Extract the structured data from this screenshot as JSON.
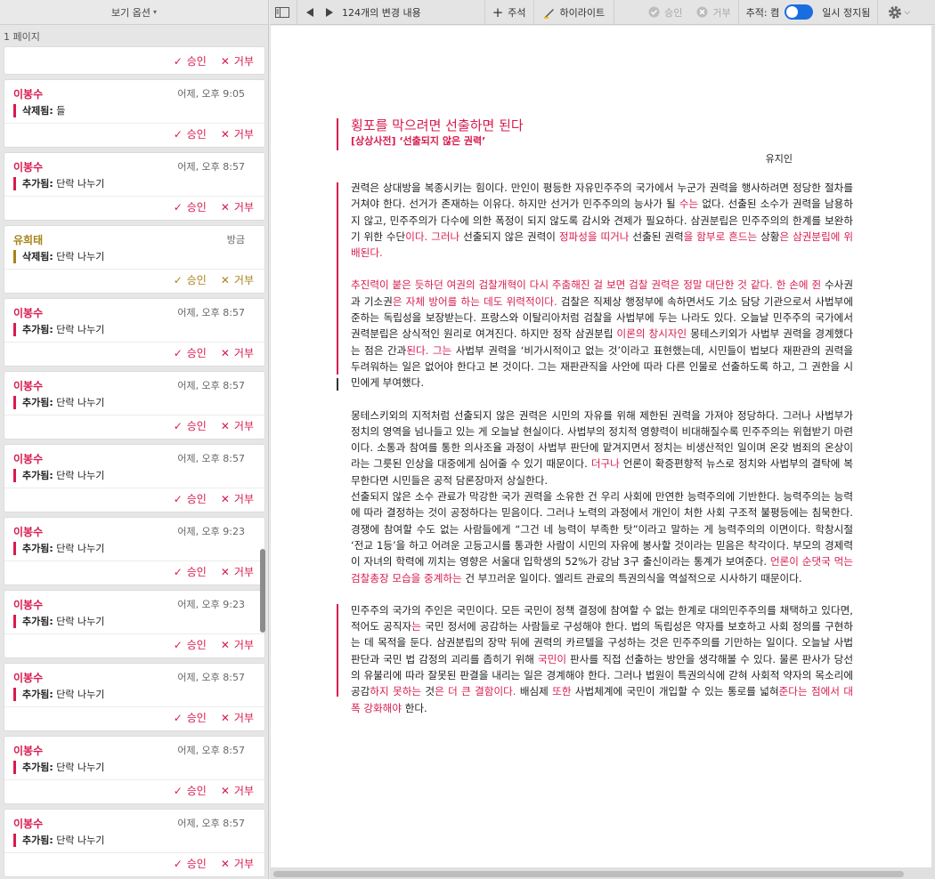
{
  "sidebar": {
    "header": "보기 옵션",
    "page_count": "1 페이지",
    "approve_label": "승인",
    "reject_label": "거부",
    "cards": [
      {
        "author": "",
        "time": "",
        "type": "",
        "text": "",
        "color": "red"
      },
      {
        "author": "이봉수",
        "time": "어제, 오후 9:05",
        "type": "삭제됨:",
        "text": "들",
        "color": "red"
      },
      {
        "author": "이봉수",
        "time": "어제, 오후 8:57",
        "type": "추가됨:",
        "text": "단락 나누기",
        "color": "red"
      },
      {
        "author": "유희태",
        "time": "방금",
        "type": "삭제됨:",
        "text": "단락 나누기",
        "color": "yellow"
      },
      {
        "author": "이봉수",
        "time": "어제, 오후 8:57",
        "type": "추가됨:",
        "text": "단락 나누기",
        "color": "red"
      },
      {
        "author": "이봉수",
        "time": "어제, 오후 8:57",
        "type": "추가됨:",
        "text": "단락 나누기",
        "color": "red"
      },
      {
        "author": "이봉수",
        "time": "어제, 오후 8:57",
        "type": "추가됨:",
        "text": "단락 나누기",
        "color": "red"
      },
      {
        "author": "이봉수",
        "time": "어제, 오후 9:23",
        "type": "추가됨:",
        "text": "단락 나누기",
        "color": "red"
      },
      {
        "author": "이봉수",
        "time": "어제, 오후 9:23",
        "type": "추가됨:",
        "text": "단락 나누기",
        "color": "red"
      },
      {
        "author": "이봉수",
        "time": "어제, 오후 8:57",
        "type": "추가됨:",
        "text": "단락 나누기",
        "color": "red"
      },
      {
        "author": "이봉수",
        "time": "어제, 오후 8:57",
        "type": "추가됨:",
        "text": "단락 나누기",
        "color": "red"
      },
      {
        "author": "이봉수",
        "time": "어제, 오후 8:57",
        "type": "추가됨:",
        "text": "단락 나누기",
        "color": "red"
      }
    ]
  },
  "toolbar": {
    "changes": "124개의 변경 내용",
    "comment": "주석",
    "highlight": "하이라이트",
    "accept": "승인",
    "reject": "거부",
    "track_label": "추적: 켬",
    "pause": "일시 정지됨"
  },
  "colors": {
    "accent": "#d81b4e",
    "author2": "#a8831a",
    "toggle": "#1a6de0"
  },
  "article": {
    "title": "횡포를 막으려면 선출하면 된다",
    "subtitle": "[상상사전] ‘선출되지 않은 권력’",
    "author": "유지인",
    "p1": [
      {
        "t": "권력은 상대방을 복종시키는 힘이다. 만인이 평등한 자유민주주의 국가에서 누군가 권력을 행사하려면 정당한 절차를 거쳐야 한다. 선거가 존재하는 이유다. 하지만 선거가 민주주의의 능사가 될 "
      },
      {
        "t": "수는",
        "c": "ins"
      },
      {
        "t": " 없다. 선출된 소수가 권력을 남용하지 않고, 민주주의가 다수에 의한 폭정이 되지 않도록 감시와 견제가 필요하다. 삼권분립은 민주주의의 한계를 보완하기 위한 수단"
      },
      {
        "t": "이다. 그러나",
        "c": "ins"
      },
      {
        "t": " 선출되지 않은 권력이 "
      },
      {
        "t": "정파성을 띠거나",
        "c": "ins"
      },
      {
        "t": " 선출된 권력"
      },
      {
        "t": "을 함부로 흔드는",
        "c": "ins"
      },
      {
        "t": " 상황"
      },
      {
        "t": "은 삼권분립에 위배된다.",
        "c": "ins"
      }
    ],
    "p2": [
      {
        "t": "추진력이 붙은 듯하던 여권의 검찰개혁이 다시 주춤해진 걸 보면 검찰 권력은 정말 대단한 것 같다. 한 손에 쥔",
        "c": "ins"
      },
      {
        "t": " 수사권과 기소권"
      },
      {
        "t": "은 자체 방어를 하는 데도 위력적이다.",
        "c": "ins"
      },
      {
        "t": " 검찰은 직제상 행정부에 속하면서도 기소 담당 기관으로서 사법부에 준하는 독립성을 보장받는다. 프랑스와 이탈리아처럼 검찰을 사법부에 두는 나라도 있다. 오늘날 민주주의 국가에서 권력분립은 상식적인 원리로 여겨진다. 하지만 정작 삼권분립 "
      },
      {
        "t": "이론의 창시자인",
        "c": "ins"
      },
      {
        "t": " 몽테스키외가 사법부 권력을 경계했다는 점은 간과"
      },
      {
        "t": "된다. 그는",
        "c": "ins"
      },
      {
        "t": " 사법부 권력을 ‘비가시적이고 없는 것’이라고 표현했는데, 시민들이 법보다 재판관의 권력을 두려워하는 일은 없어야 한다고 본 것이다. 그는 재판관직을 사안에 따라 다른 인물로 선출하도록 하고, 그 권한을 시민에게 부여했다."
      }
    ],
    "p3": [
      {
        "t": "몽테스키외의 지적처럼 선출되지 않은 권력은 시민의 자유를 위해 제한된 권력을 가져야 정당하다. 그러나 사법부가 정치의 영역을 넘나들고 있는 게 오늘날 현실이다. 사법부의 정치적 영향력이 비대해질수록 민주주의는 위협받기 마련이다. 소통과 참여를 통한 의사조율 과정이 사법부 판단에 맡겨지면서 정치는 비생산적인 일이며 온갖 범죄의 온상이라는 그릇된 인상을 대중에게 심어줄 수 있기 때문이다. "
      },
      {
        "t": "더구나",
        "c": "ins"
      },
      {
        "t": " 언론이 확증편향적 뉴스로 정치와 사법부의 결탁에 복무한다면 시민들은 공적 담론장마저 상실한다."
      }
    ],
    "p4": [
      {
        "t": "선출되지 않은 소수 관료가 막강한 국가 권력을 소유한 건 우리 사회에 만연한 능력주의에 기반한다. 능력주의는 능력에 따라 결정하는 것이 공정하다는 믿음이다. 그러나 노력의 과정에서 개인이 처한 사회 구조적 불평등에는 침묵한다. 경쟁에 참여할 수도 없는 사람들에게 “그건 네 능력이 부족한 탓”이라고 말하는 게 능력주의의 이면이다. 학창시절 ‘전교 1등’을 하고 어려운 고등고시를 통과한 사람이 시민의 자유에 봉사할 것이라는 믿음은 착각이다. 부모의 경제력이 자녀의 학력에 끼치는 영향은 서울대 입학생의 52%가 강남 3구 출신이라는 통계가 보여준다. "
      },
      {
        "t": "언론이 순댓국 먹는 검찰총장 모습을 중계하는",
        "c": "ins"
      },
      {
        "t": " 건 부끄러운 일이다. 엘리트 관료의 특권의식을 역설적으로 시사하기 때문이다."
      }
    ],
    "p5": [
      {
        "t": "민주주의 국가의 주인은 국민이다. 모든 국민이 정책 결정에 참여할 수 없는 한계로 대의민주주의를 채택하고 있다면, 적어도 공직자"
      },
      {
        "t": "는",
        "c": "ins"
      },
      {
        "t": " 국민 정서에 공감하는 사람들로 구성해야 한다. 법의 독립성은 약자를 보호하고 사회 정의를 구현하는 데 목적을 둔다. 삼권분립의 장막 뒤에 권력의 카르텔을 구성하는 것은 민주주의를 기만하는 일이다. 오늘날 사법 판단과 국민 법 감정의 괴리를 좁히기 위해 "
      },
      {
        "t": "국민이",
        "c": "ins"
      },
      {
        "t": " 판사를 직접 선출하는 방안을 생각해볼 수 있다. 물론 판사가 당선의 유불리에 따라 잘못된 판결을 내리는 일은 경계해야 한다. 그러나 법원이 특권의식에 갇혀 사회적 약자의 목소리에 공감"
      },
      {
        "t": "하지 못하는",
        "c": "ins"
      },
      {
        "t": " 것"
      },
      {
        "t": "은 더 큰 결함이다.",
        "c": "ins"
      },
      {
        "t": " 배심제 "
      },
      {
        "t": "또한",
        "c": "ins"
      },
      {
        "t": " 사법체계에 국민이 개입할 수 있는 통로를 넓혀"
      },
      {
        "t": "준다는 점에서 대폭 강화해야",
        "c": "ins"
      },
      {
        "t": " 한다."
      }
    ]
  }
}
